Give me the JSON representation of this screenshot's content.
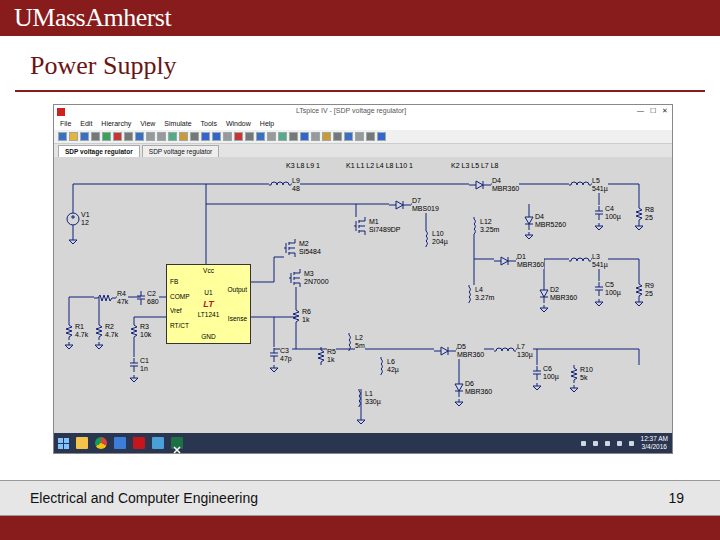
{
  "slide": {
    "logo": "UMassAmherst",
    "title": "Power Supply",
    "footer": "Electrical and Computer Engineering",
    "page": "19"
  },
  "window": {
    "title": "LTspice IV - [SDP voltage regulator]",
    "controls": [
      "—",
      "☐",
      "✕"
    ]
  },
  "menu": [
    "File",
    "Edit",
    "Hierarchy",
    "View",
    "Simulate",
    "Tools",
    "Window",
    "Help"
  ],
  "tabs": [
    {
      "label": "SDP voltage regulator",
      "selected": true
    },
    {
      "label": "SDP voltage regulator",
      "selected": false
    }
  ],
  "schematic": {
    "directives": [
      "K3 L8 L9 1",
      "K1 L1 L2 L4 L8 L10 1",
      "K2 L3 L5 L7 L8"
    ],
    "chip": {
      "ref": "U1",
      "part": "LT1241",
      "logo": "LT",
      "top": "Vcc",
      "bottom": "GND",
      "left": [
        "FB",
        "COMP",
        "Vref",
        "RT/CT"
      ],
      "right": [
        "Output",
        "Isense"
      ]
    },
    "components": [
      {
        "ref": "V1",
        "value": "12",
        "kind": "source"
      },
      {
        "ref": "L9",
        "value": "48",
        "kind": "inductor"
      },
      {
        "ref": "D7",
        "value": "MBS019",
        "kind": "diode"
      },
      {
        "ref": "L10",
        "value": "204µ",
        "kind": "inductor"
      },
      {
        "ref": "D4",
        "value": "MBR360",
        "kind": "diode"
      },
      {
        "ref": "L5",
        "value": "541µ",
        "kind": "inductor"
      },
      {
        "ref": "C4",
        "value": "100µ",
        "kind": "cap"
      },
      {
        "ref": "R8",
        "value": "25",
        "kind": "resistor"
      },
      {
        "ref": "L12",
        "value": "3.25m",
        "kind": "inductor"
      },
      {
        "ref": "D4",
        "value": "MBR5260",
        "kind": "diode"
      },
      {
        "ref": "M1",
        "value": "Si7489DP",
        "kind": "mosfet"
      },
      {
        "ref": "M2",
        "value": "Si5484",
        "kind": "mosfet"
      },
      {
        "ref": "M3",
        "value": "2N7000",
        "kind": "mosfet"
      },
      {
        "ref": "R6",
        "value": "1k",
        "kind": "resistor"
      },
      {
        "ref": "R4",
        "value": "47k",
        "kind": "resistor"
      },
      {
        "ref": "C2",
        "value": "680",
        "kind": "cap"
      },
      {
        "ref": "R1",
        "value": "4.7k",
        "kind": "resistor"
      },
      {
        "ref": "R2",
        "value": "4.7k",
        "kind": "resistor"
      },
      {
        "ref": "R3",
        "value": "10k",
        "kind": "resistor"
      },
      {
        "ref": "C1",
        "value": "1n",
        "kind": "cap"
      },
      {
        "ref": "C3",
        "value": "47p",
        "kind": "cap"
      },
      {
        "ref": "R5",
        "value": "1k",
        "kind": "resistor"
      },
      {
        "ref": "L2",
        "value": "5m",
        "kind": "inductor"
      },
      {
        "ref": "L6",
        "value": "42µ",
        "kind": "inductor"
      },
      {
        "ref": "L1",
        "value": "330µ",
        "kind": "inductor"
      },
      {
        "ref": "D5",
        "value": "MBR360",
        "kind": "diode"
      },
      {
        "ref": "D6",
        "value": "MBR360",
        "kind": "diode"
      },
      {
        "ref": "L7",
        "value": "130µ",
        "kind": "inductor"
      },
      {
        "ref": "C6",
        "value": "100µ",
        "kind": "cap"
      },
      {
        "ref": "R10",
        "value": "5k",
        "kind": "resistor"
      },
      {
        "ref": "L4",
        "value": "3.27m",
        "kind": "inductor"
      },
      {
        "ref": "D1",
        "value": "MBR360",
        "kind": "diode"
      },
      {
        "ref": "D2",
        "value": "MBR360",
        "kind": "diode"
      },
      {
        "ref": "L3",
        "value": "541µ",
        "kind": "inductor"
      },
      {
        "ref": "C5",
        "value": "100µ",
        "kind": "cap"
      },
      {
        "ref": "R9",
        "value": "25",
        "kind": "resistor"
      }
    ]
  },
  "taskbar": {
    "time": "12:37 AM",
    "date": "3/4/2016"
  }
}
